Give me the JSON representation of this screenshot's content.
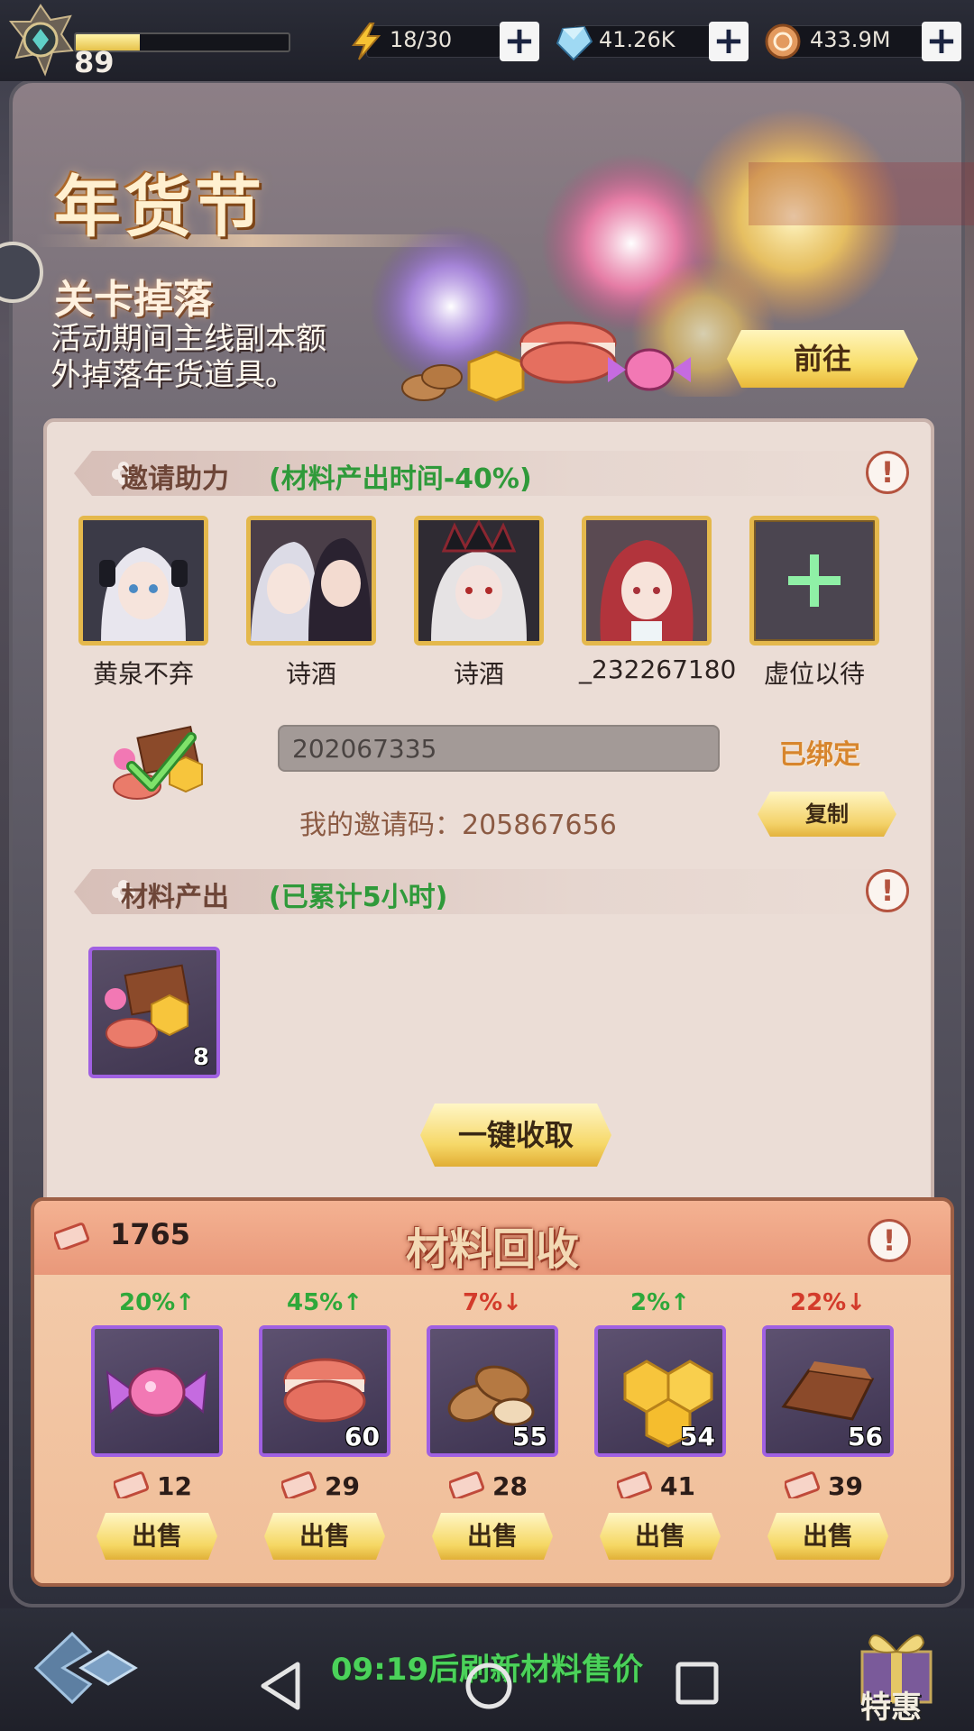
{
  "top_bar": {
    "level": "89",
    "exp_fraction": 0.3,
    "energy": "18/30",
    "diamonds": "41.26K",
    "coins": "433.9M"
  },
  "banner": {
    "title": "年货节",
    "subtitle": "关卡掉落",
    "description": "活动期间主线副本额外掉落年货道具。",
    "goto_label": "前往"
  },
  "invite": {
    "title": "邀请助力",
    "bonus": "(材料产出时间-40%)",
    "helpers": [
      {
        "name": "黄泉不弃"
      },
      {
        "name": "诗酒"
      },
      {
        "name": "诗酒"
      },
      {
        "name": "_232267180"
      },
      {
        "name": "虚位以待"
      }
    ],
    "bound_code": "202067335",
    "bound_label": "已绑定",
    "my_code_label": "我的邀请码：205867656",
    "copy_label": "复制"
  },
  "production": {
    "title": "材料产出",
    "accumulated": "(已累计5小时)",
    "item_count": "8",
    "collect_label": "一键收取"
  },
  "recycle": {
    "title": "材料回收",
    "tickets": "1765",
    "items": [
      {
        "icon": "candy-icon",
        "trend": "20%↑",
        "direction": "up",
        "count": "",
        "price": "12",
        "sell_label": "出售"
      },
      {
        "icon": "macaron-icon",
        "trend": "45%↑",
        "direction": "up",
        "count": "60",
        "price": "29",
        "sell_label": "出售"
      },
      {
        "icon": "almond-icon",
        "trend": "7%↓",
        "direction": "down",
        "count": "55",
        "price": "28",
        "sell_label": "出售"
      },
      {
        "icon": "honeycomb-icon",
        "trend": "2%↑",
        "direction": "up",
        "count": "54",
        "price": "41",
        "sell_label": "出售"
      },
      {
        "icon": "chocolate-icon",
        "trend": "22%↓",
        "direction": "down",
        "count": "56",
        "price": "39",
        "sell_label": "出售"
      }
    ],
    "colors": {
      "up": "#2ea83a",
      "down": "#d33b2b"
    }
  },
  "bottom": {
    "refresh_text": "09:19后刷新材料售价",
    "promo_label": "特惠"
  }
}
